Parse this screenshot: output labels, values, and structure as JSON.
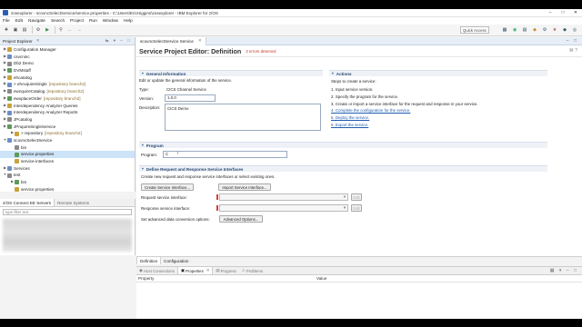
{
  "window": {
    "title": "zosexplorer - scovncSelectService/service.properties - C:\\Users\\EricHiggins\\zosexplorer - IBM Explorer for z/OS"
  },
  "menu": [
    "File",
    "Edit",
    "Navigate",
    "Search",
    "Project",
    "Run",
    "Window",
    "Help"
  ],
  "toolbar": {
    "quick_access": "Quick Access"
  },
  "project_explorer": {
    "tab_label": "Project Explorer",
    "items": [
      {
        "label": "Configuration Manager",
        "indent": 0,
        "twisty": ">",
        "decor": ""
      },
      {
        "label": "csvcninc",
        "indent": 0,
        "twisty": ">",
        "decor": ""
      },
      {
        "label": "Db2 Demo",
        "indent": 0,
        "twisty": ">",
        "decor": ""
      },
      {
        "label": "DVMstaff",
        "indent": 0,
        "twisty": ">",
        "decor": ""
      },
      {
        "label": "ehcatalog",
        "indent": 0,
        "twisty": ">",
        "decor": ""
      },
      {
        "label": "> ehcvquireSingle",
        "indent": 0,
        "twisty": ">",
        "decor": "[repository branch2]"
      },
      {
        "label": "ewnquireCatalog",
        "indent": 0,
        "twisty": ">",
        "decor": "[repository branch2]"
      },
      {
        "label": "ewxplaceOrder",
        "indent": 0,
        "twisty": ">",
        "decor": "[repository branch2]"
      },
      {
        "label": "Interdependency Analyzer Queries",
        "indent": 0,
        "twisty": ">",
        "decor": ""
      },
      {
        "label": "Interdependency Analyzer Reports",
        "indent": 0,
        "twisty": ">",
        "decor": ""
      },
      {
        "label": "JPcatalog",
        "indent": 0,
        "twisty": ">",
        "decor": ""
      },
      {
        "label": "JPnquireSingleService",
        "indent": 0,
        "twisty": ">",
        "decor": ""
      },
      {
        "label": "> repository",
        "indent": 1,
        "twisty": ">",
        "decor": "[repository branch2]"
      },
      {
        "label": "scovncSelectService",
        "indent": 0,
        "twisty": "v",
        "decor": ""
      },
      {
        "label": "bin",
        "indent": 1,
        "twisty": "",
        "decor": ""
      },
      {
        "label": "service.properties",
        "indent": 1,
        "twisty": "",
        "decor": "",
        "selected": true
      },
      {
        "label": "service-interfaces",
        "indent": 1,
        "twisty": "",
        "decor": ""
      },
      {
        "label": "Services",
        "indent": 0,
        "twisty": ">",
        "decor": ""
      },
      {
        "label": "test",
        "indent": 0,
        "twisty": "v",
        "decor": ""
      },
      {
        "label": "bin",
        "indent": 1,
        "twisty": ">",
        "decor": ""
      },
      {
        "label": "service.properties",
        "indent": 1,
        "twisty": "",
        "decor": ""
      }
    ]
  },
  "servers_view": {
    "tab_active": "z/OS Connect EE Servers",
    "tab_inactive": "Remote Systems",
    "filter_placeholder": "type filter text"
  },
  "editor": {
    "tab_label": "scovncSelectService Service",
    "header": "Service Project Editor: Definition",
    "errors": "3 errors detected",
    "general": {
      "heading": "General Information",
      "desc": "Edit or update the general information of the service.",
      "type_label": "Type:",
      "type_value": "CICS Channel Service",
      "version_label": "Version:",
      "version_value": "1.0.0",
      "description_label": "Description:",
      "description_value": "CICS Demo"
    },
    "actions": {
      "heading": "Actions",
      "intro": "Steps to create a service:",
      "steps": [
        {
          "text": "1. Input service version.",
          "link": false
        },
        {
          "text": "2. Specify the program for the service.",
          "link": false
        },
        {
          "text": "3. Create or import a service interface for the request and response in your service.",
          "link": false
        },
        {
          "text": "4. Complete the configuration for the service.",
          "link": true
        },
        {
          "text": "5. Deploy the service.",
          "link": true
        },
        {
          "text": "6. Export the service.",
          "link": true
        }
      ]
    },
    "program": {
      "heading": "Program",
      "label": "Program:",
      "value": "C"
    },
    "interfaces": {
      "heading": "Define Request and Response Service Interfaces",
      "desc": "Create new request and response service interfaces or select existing ones.",
      "create_button": "Create Service Interface...",
      "import_button": "Import Service Interface...",
      "request_label": "Request service interface:",
      "response_label": "Response service interface:",
      "edit_label": "Edit",
      "advanced_label": "Set advanced data conversion options:",
      "advanced_button": "Advanced Options..."
    },
    "page_tabs": [
      "Definition",
      "Configuration"
    ]
  },
  "properties_view": {
    "tabs": [
      "Host Connections",
      "Properties",
      "Progress",
      "Problems"
    ],
    "active_tab": "Properties",
    "col_property": "Property",
    "col_value": "Value"
  }
}
